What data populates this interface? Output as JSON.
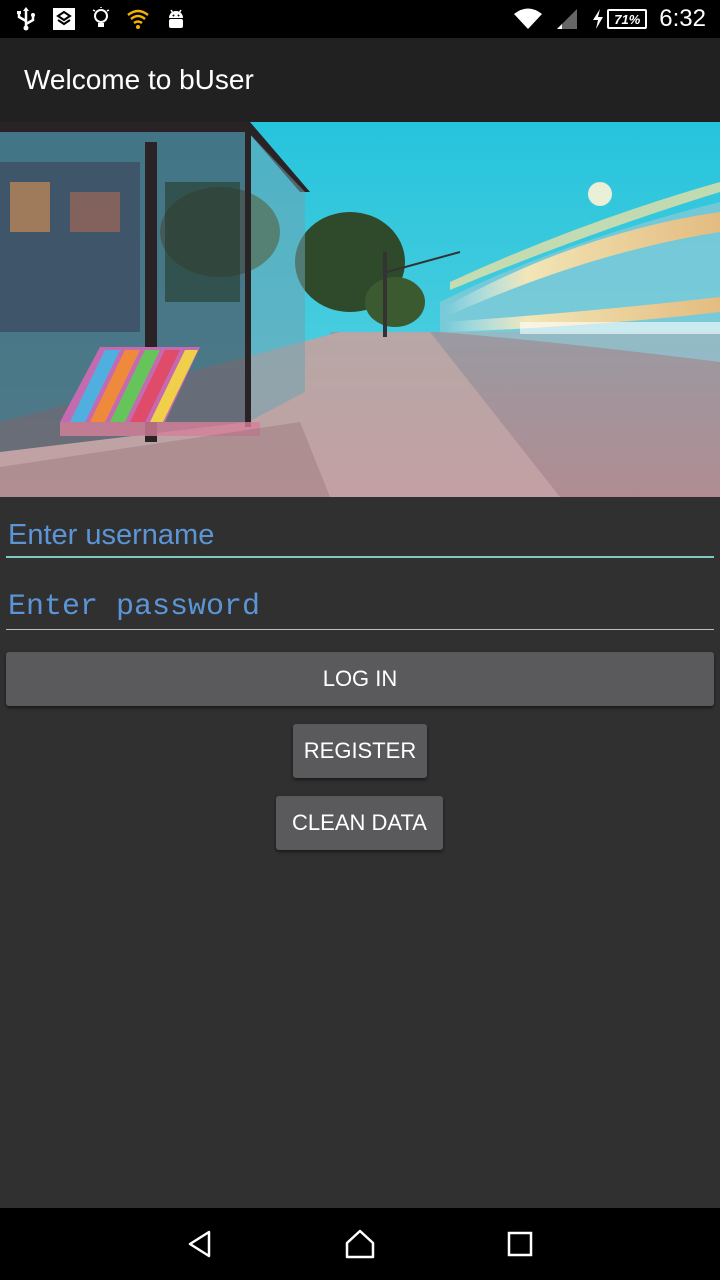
{
  "status_bar": {
    "left_icons": [
      "usb-icon",
      "notification-app-icon",
      "bulb-icon",
      "wifi-alert-icon",
      "android-icon"
    ],
    "right_icons": [
      "wifi-icon",
      "signal-icon",
      "charging-icon"
    ],
    "battery": "71%",
    "clock": "6:32"
  },
  "app_bar": {
    "title": "Welcome to bUser"
  },
  "hero": {
    "image": "bus-stop-street-photo"
  },
  "form": {
    "username_placeholder": "Enter username",
    "password_placeholder": "Enter password"
  },
  "buttons": {
    "login": "LOG IN",
    "register": "REGISTER",
    "clean": "CLEAN DATA"
  },
  "nav_bar": {
    "icons": [
      "back-icon",
      "home-icon",
      "recents-icon"
    ]
  },
  "colors": {
    "background": "#303030",
    "app_bar": "#212121",
    "hint": "#5b95d6",
    "accent_line": "#7fcbc4",
    "button": "#5a5a5c"
  }
}
